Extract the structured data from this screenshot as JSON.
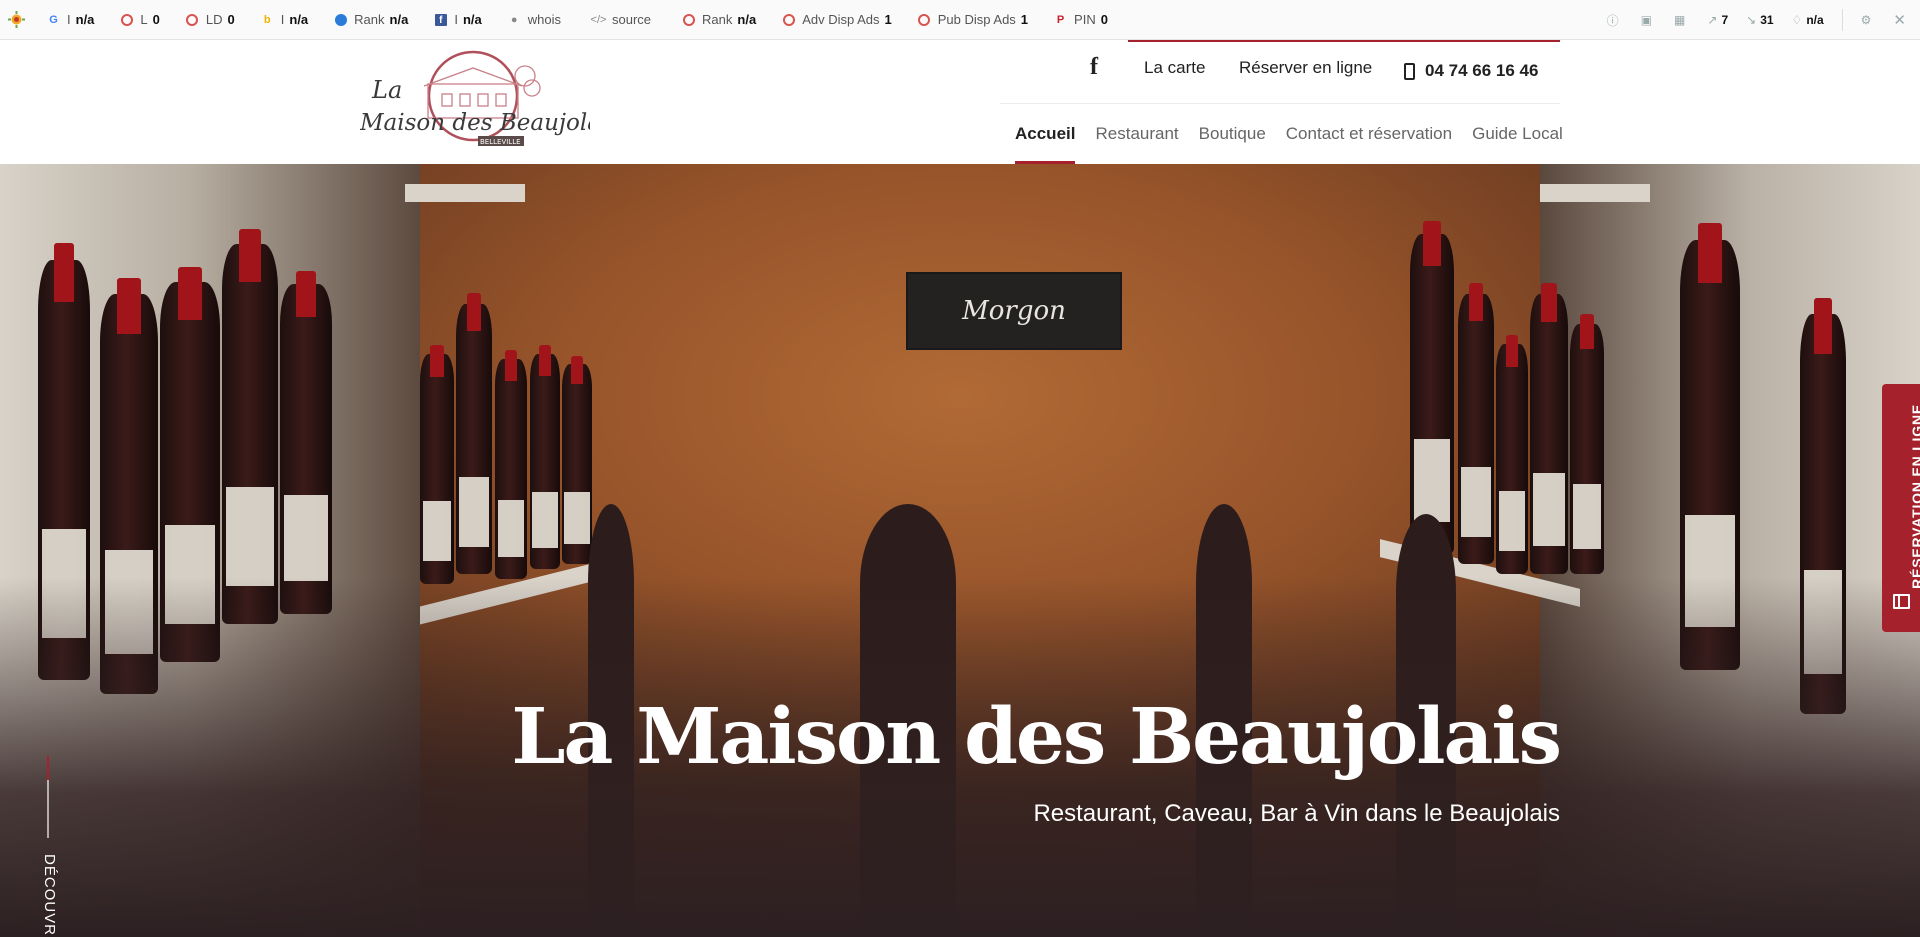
{
  "seo_toolbar": {
    "items": [
      {
        "icon": "google-icon",
        "label": "I",
        "value": "n/a"
      },
      {
        "icon": "circle-icon",
        "label": "L",
        "value": "0"
      },
      {
        "icon": "circle-icon",
        "label": "LD",
        "value": "0"
      },
      {
        "icon": "bing-icon",
        "label": "I",
        "value": "n/a"
      },
      {
        "icon": "alexa-icon",
        "label": "Rank",
        "value": "n/a"
      },
      {
        "icon": "facebook-icon",
        "label": "I",
        "value": "n/a"
      },
      {
        "icon": "person-icon",
        "label": "whois",
        "value": ""
      },
      {
        "icon": "code-icon",
        "label": "source",
        "value": ""
      },
      {
        "icon": "circle-icon",
        "label": "Rank",
        "value": "n/a"
      },
      {
        "icon": "circle-icon",
        "label": "Adv Disp Ads",
        "value": "1"
      },
      {
        "icon": "circle-icon",
        "label": "Pub Disp Ads",
        "value": "1"
      },
      {
        "icon": "pinterest-icon",
        "label": "PIN",
        "value": "0"
      }
    ],
    "right_items": [
      {
        "icon": "info-icon",
        "value": ""
      },
      {
        "icon": "monitor-icon",
        "value": ""
      },
      {
        "icon": "page-icon",
        "value": ""
      },
      {
        "icon": "external-link-icon",
        "value": "7"
      },
      {
        "icon": "internal-link-icon",
        "value": "31"
      },
      {
        "icon": "diamond-icon",
        "value": "n/a"
      }
    ]
  },
  "header": {
    "logo_text_line1": "La",
    "logo_text_line2": "Maison des Beaujolais",
    "logo_subtext": "BELLEVILLE",
    "facebook_glyph": "f",
    "top_links": [
      "La carte",
      "Réserver en ligne"
    ],
    "phone": "04 74 66 16 46",
    "nav": [
      {
        "label": "Accueil",
        "active": true
      },
      {
        "label": "Restaurant",
        "active": false
      },
      {
        "label": "Boutique",
        "active": false
      },
      {
        "label": "Contact et réservation",
        "active": false
      },
      {
        "label": "Guide Local",
        "active": false
      }
    ]
  },
  "hero": {
    "chalkboard": "Morgon",
    "title": "La Maison des Beaujolais",
    "subtitle": "Restaurant, Caveau, Bar à Vin dans le Beaujolais",
    "discover": "DÉCOUVRIR",
    "reserve_tab": "RÉSERVATION EN LIGNE"
  },
  "colors": {
    "accent": "#a5212c",
    "hero_dark": "#2d2022",
    "wall": "#a5602f"
  }
}
